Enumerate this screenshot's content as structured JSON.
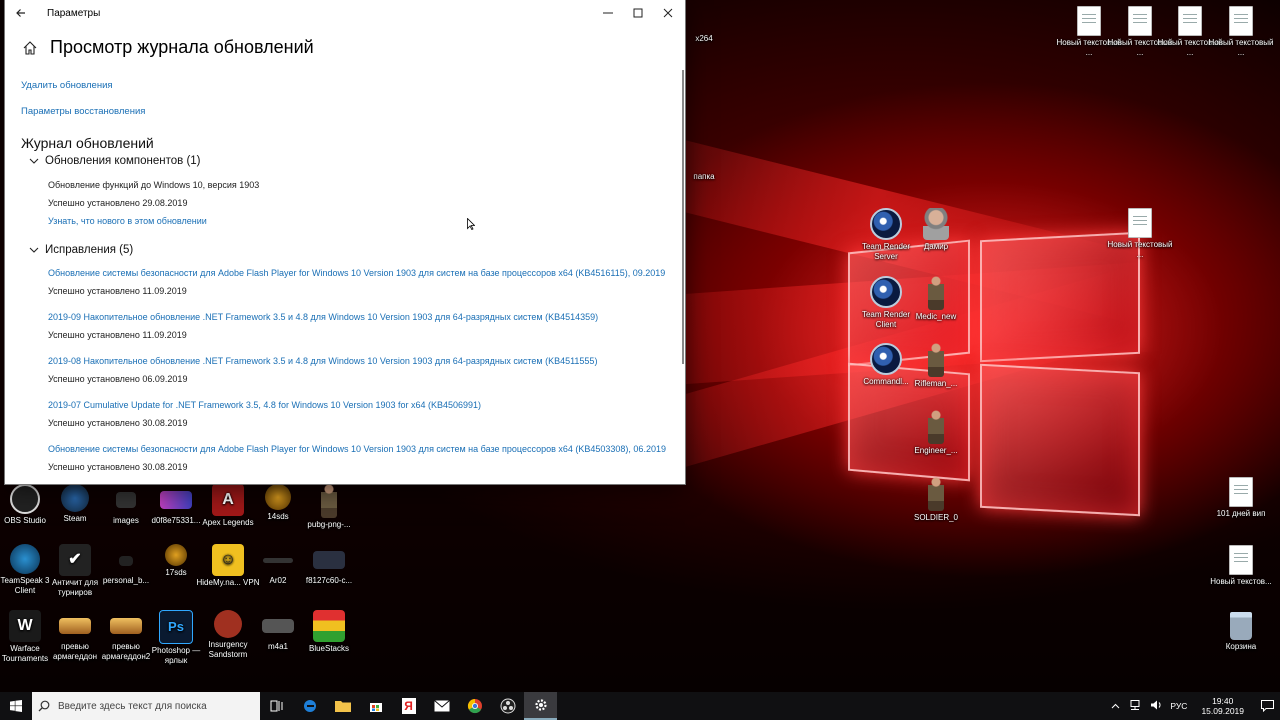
{
  "window": {
    "title": "Параметры",
    "page_title": "Просмотр журнала обновлений",
    "links": {
      "uninstall": "Удалить обновления",
      "recovery": "Параметры восстановления"
    },
    "history_title": "Журнал обновлений",
    "groups": {
      "components": {
        "header": "Обновления компонентов (1)",
        "items": [
          {
            "title": "Обновление функций до Windows 10, версия 1903",
            "status": "Успешно установлено 29.08.2019",
            "link": "Узнать, что нового в этом обновлении"
          }
        ]
      },
      "fixes": {
        "header": "Исправления (5)",
        "items": [
          {
            "title": "Обновление системы безопасности для Adobe Flash Player for Windows 10 Version 1903 для систем на базе процессоров x64 (KB4516115), 09.2019",
            "status": "Успешно установлено 11.09.2019"
          },
          {
            "title": "2019-09 Накопительное обновление .NET Framework 3.5 и 4.8 для Windows 10 Version 1903 для 64-разрядных систем (KB4514359)",
            "status": "Успешно установлено 11.09.2019"
          },
          {
            "title": "2019-08 Накопительное обновление .NET Framework 3.5 и 4.8 для Windows 10 Version 1903 для 64-разрядных систем (KB4511555)",
            "status": "Успешно установлено 06.09.2019"
          },
          {
            "title": "2019-07 Cumulative Update for .NET Framework 3.5, 4.8 for Windows 10 Version 1903 for x64 (KB4506991)",
            "status": "Успешно установлено 30.08.2019"
          },
          {
            "title": "Обновление системы безопасности для Adobe Flash Player for Windows 10 Version 1903 для систем на базе процессоров x64 (KB4503308), 06.2019",
            "status": "Успешно установлено 30.08.2019"
          }
        ]
      }
    }
  },
  "desktop": {
    "icons": [
      {
        "label": "OBS Studio",
        "icon": "obs-icon"
      },
      {
        "label": "Steam",
        "icon": "steam-icon"
      },
      {
        "label": "images",
        "icon": "folder-icon"
      },
      {
        "label": "d0f8e75331...",
        "icon": "image-icon"
      },
      {
        "label": "Apex Legends",
        "icon": "apex-icon"
      },
      {
        "label": "14sds",
        "icon": "emblem-icon"
      },
      {
        "label": "pubg-png-...",
        "icon": "image-icon"
      },
      {
        "label": "TeamSpeak 3 Client",
        "icon": "teamspeak-icon"
      },
      {
        "label": "Античит для турниров",
        "icon": "shield-icon"
      },
      {
        "label": "personal_b...",
        "icon": "image-icon"
      },
      {
        "label": "17sds",
        "icon": "emblem-icon"
      },
      {
        "label": "HideMy.na... VPN",
        "icon": "vpn-icon"
      },
      {
        "label": "Ar02",
        "icon": "rifle-icon"
      },
      {
        "label": "f8127c60-c...",
        "icon": "image-icon"
      },
      {
        "label": "Warface Tournaments",
        "icon": "warface-icon"
      },
      {
        "label": "превью армагеддон",
        "icon": "image-icon"
      },
      {
        "label": "превью армагеддон2",
        "icon": "image-icon"
      },
      {
        "label": "Photoshop — ярлык",
        "icon": "photoshop-icon"
      },
      {
        "label": "Insurgency Sandstorm",
        "icon": "insurgency-icon"
      },
      {
        "label": "m4a1",
        "icon": "rifle-icon"
      },
      {
        "label": "BlueStacks",
        "icon": "bluestacks-icon"
      },
      {
        "label": "Новый текстовый ...",
        "icon": "text-document-icon"
      },
      {
        "label": "Новый текстовый ...",
        "icon": "text-document-icon"
      },
      {
        "label": "Новый текстовый ...",
        "icon": "text-document-icon"
      },
      {
        "label": "Новый текстовый ...",
        "icon": "text-document-icon"
      },
      {
        "label": "Team Render Server",
        "icon": "cinema4d-icon"
      },
      {
        "label": "Дамир",
        "icon": "person-icon"
      },
      {
        "label": "Новый текстовый ...",
        "icon": "text-document-icon"
      },
      {
        "label": "Team Render Client",
        "icon": "cinema4d-icon"
      },
      {
        "label": "Medic_new",
        "icon": "soldier-icon"
      },
      {
        "label": "Commandl...",
        "icon": "cinema4d-icon"
      },
      {
        "label": "Rifleman_...",
        "icon": "soldier-icon"
      },
      {
        "label": "Engineer_...",
        "icon": "soldier-icon"
      },
      {
        "label": "SOLDIER_0",
        "icon": "soldier-icon"
      },
      {
        "label": "101 дней вип",
        "icon": "text-document-icon"
      },
      {
        "label": "Новый текстов...",
        "icon": "text-document-icon"
      },
      {
        "label": "Корзина",
        "icon": "recycle-bin-icon"
      },
      {
        "label": "x264",
        "icon": "folder-icon"
      },
      {
        "label": "папка",
        "icon": "folder-icon"
      }
    ]
  },
  "taskbar": {
    "search_placeholder": "Введите здесь текст для поиска",
    "language": "РУС",
    "time": "19:40",
    "date": "15.09.2019"
  }
}
